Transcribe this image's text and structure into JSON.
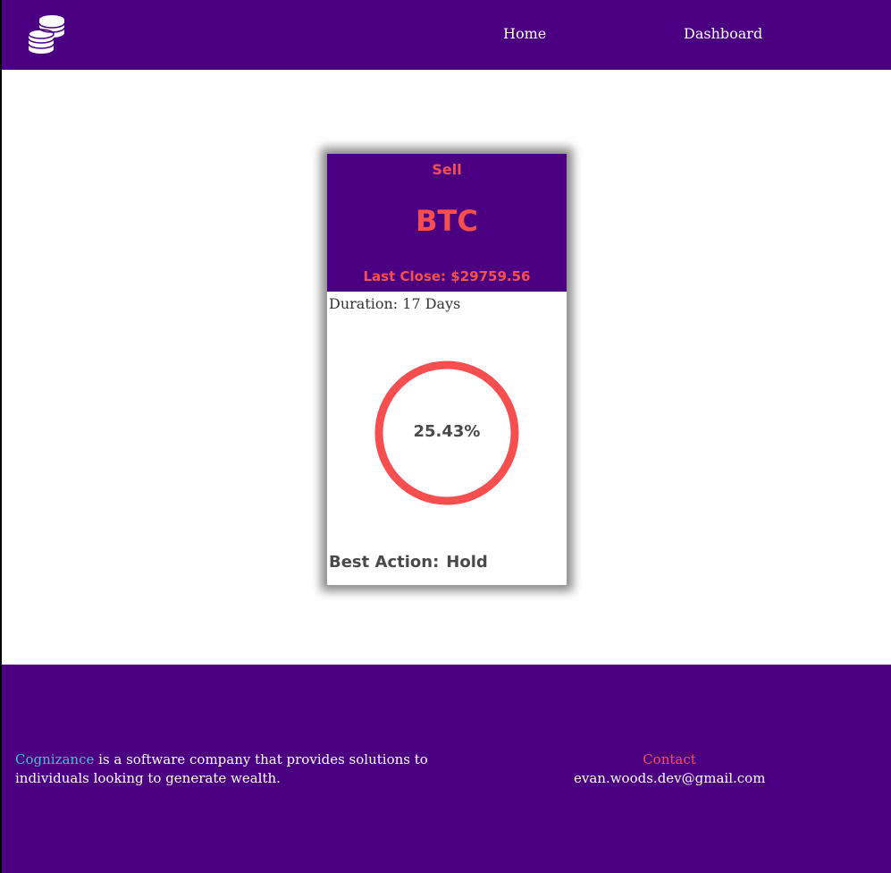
{
  "nav": {
    "logo_icon": "coin-stack-icon",
    "links": [
      "Home",
      "Dashboard"
    ]
  },
  "card": {
    "signal": "Sell",
    "ticker": "BTC",
    "last_close": "Last Close: $29759.56",
    "duration": "Duration: 17 Days",
    "gauge_value": "25.43%",
    "best_action_label": "Best Action:",
    "best_action_value": "Hold"
  },
  "footer": {
    "brand": "Cognizance",
    "tagline": " is a software company that provides solutions to individuals looking to generate wealth.",
    "contact_title": "Contact",
    "contact_email": "evan.woods.dev@gmail.com"
  },
  "colors": {
    "primary": "#4b0082",
    "accent": "#f74f4f",
    "brand": "#45c2d1",
    "text_dark": "#4a4a4a"
  }
}
